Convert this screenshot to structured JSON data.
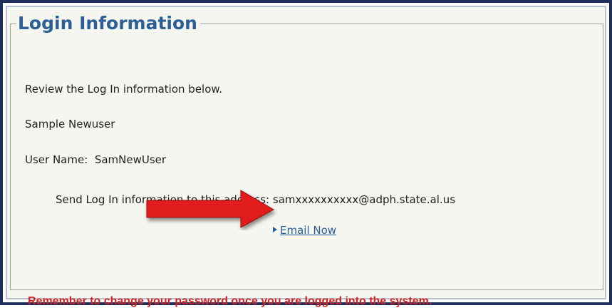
{
  "panel": {
    "legend": "Login Information",
    "review_text": "Review the Log In information below.",
    "full_name": "Sample Newuser",
    "username_label": "User Name:",
    "username_value": "SamNewUser",
    "send_text": "Send Log In information to this address:",
    "email_address": "samxxxxxxxxxx@adph.state.al.us",
    "email_link": "Email Now",
    "warning": "Remember to change your password once you are logged into the system."
  },
  "annotation": {
    "arrow_color": "#e01e1e",
    "arrow_icon": "red-arrow-icon"
  },
  "colors": {
    "legend": "#2c5f95",
    "link": "#2c5f95",
    "warning": "#d42020",
    "panel_bg": "#f4f6ef",
    "frame": "#1f2f5c"
  }
}
